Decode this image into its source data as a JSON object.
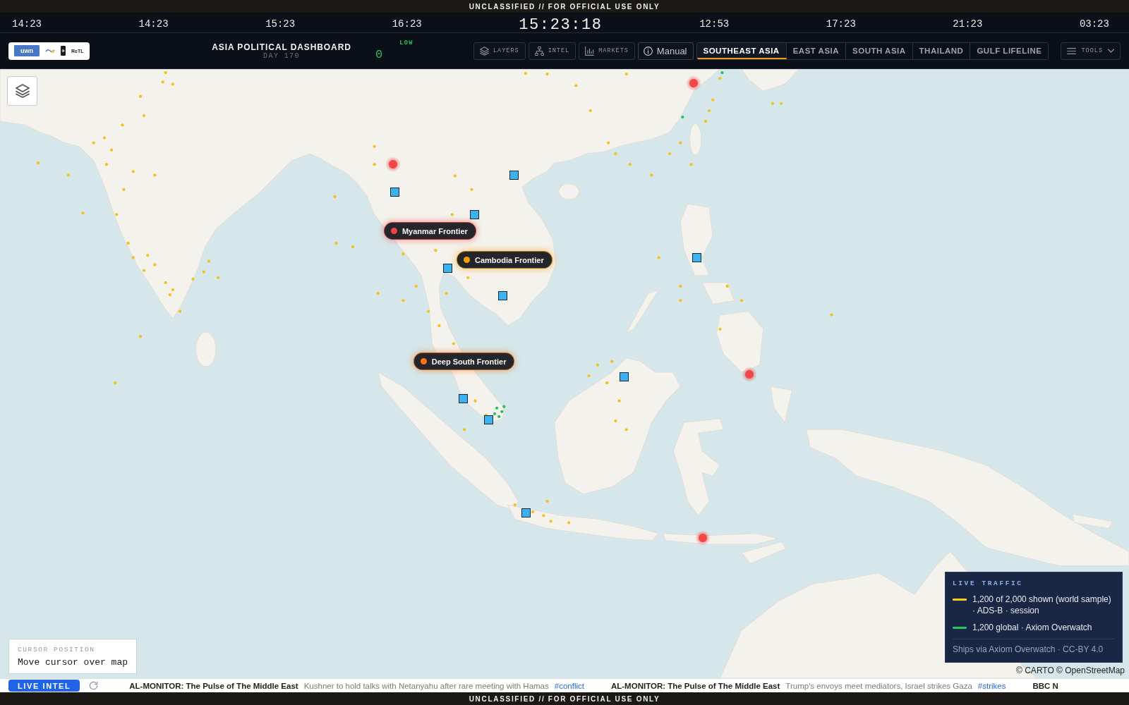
{
  "top_banner": {
    "text": "UNCLASSIFIED // FOR OFFICIAL USE ONLY"
  },
  "clocks": [
    {
      "kind": "zone",
      "time": "14:23"
    },
    {
      "kind": "zone",
      "time": "14:23"
    },
    {
      "kind": "zone",
      "time": "15:23"
    },
    {
      "kind": "zone",
      "time": "16:23"
    },
    {
      "kind": "main",
      "time": "15:23:18"
    },
    {
      "kind": "zone",
      "time": "12:53"
    },
    {
      "kind": "zone",
      "time": "17:23"
    },
    {
      "kind": "zone",
      "time": "21:23"
    },
    {
      "kind": "zone",
      "time": "03:23"
    }
  ],
  "header": {
    "logos": [
      {
        "kind": "badge",
        "text": "uwn"
      },
      {
        "kind": "mark"
      },
      {
        "kind": "mark"
      },
      {
        "kind": "word",
        "text": "ReTL"
      }
    ],
    "title": "ASIA POLITICAL DASHBOARD",
    "subtitle": "DAY 170",
    "threat": {
      "count": "0",
      "level": "LOW"
    },
    "buttons": [
      {
        "kind": "mono",
        "label": "LAYERS"
      },
      {
        "kind": "mono",
        "label": "INTEL"
      },
      {
        "kind": "mono",
        "label": "MARKETS"
      },
      {
        "kind": "plain",
        "label": "Manual"
      }
    ],
    "tabs": [
      {
        "label": "SOUTHEAST ASIA",
        "selected": true
      },
      {
        "label": "EAST ASIA",
        "selected": false
      },
      {
        "label": "SOUTH ASIA",
        "selected": false
      },
      {
        "label": "THAILAND",
        "selected": false
      },
      {
        "label": "GULF LIFELINE",
        "selected": false
      }
    ],
    "tools": {
      "label": "TOOLS"
    }
  },
  "map": {
    "frontiers": [
      {
        "label": "Myanmar Frontier",
        "color": "#ef4444"
      },
      {
        "label": "Cambodia Frontier",
        "color": "#f59e0b"
      },
      {
        "label": "Deep South Frontier",
        "color": "#f97316"
      }
    ],
    "cursor": {
      "label": "CURSOR POSITION",
      "value": "Move cursor over map"
    },
    "legend": {
      "title": "LIVE TRAFFIC",
      "items": [
        {
          "color": "#facc15",
          "text": "1,200 of 2,000 shown (world sample) · ADS-B · session"
        },
        {
          "color": "#22c55e",
          "text": "1,200 global · Axiom Overwatch"
        }
      ],
      "note": "Ships via Axiom Overwatch · CC-BY 4.0"
    },
    "attribution": "© CARTO © OpenStreetMap"
  },
  "ticker": {
    "button": "LIVE INTEL",
    "items": [
      {
        "source": "AL-MONITOR: The Pulse of The Middle East",
        "headline": "Kushner to hold talks with Netanyahu after rare meeting with Hamas",
        "tag": "#conflict"
      },
      {
        "source": "AL-MONITOR: The Pulse of The Middle East",
        "headline": "Trump's envoys meet mediators, Israel strikes Gaza",
        "tag": "#strikes"
      },
      {
        "source": "BBC N"
      }
    ]
  },
  "bottom_banner": {
    "text": "UNCLASSIFIED // FOR OFFICIAL USE ONLY"
  }
}
